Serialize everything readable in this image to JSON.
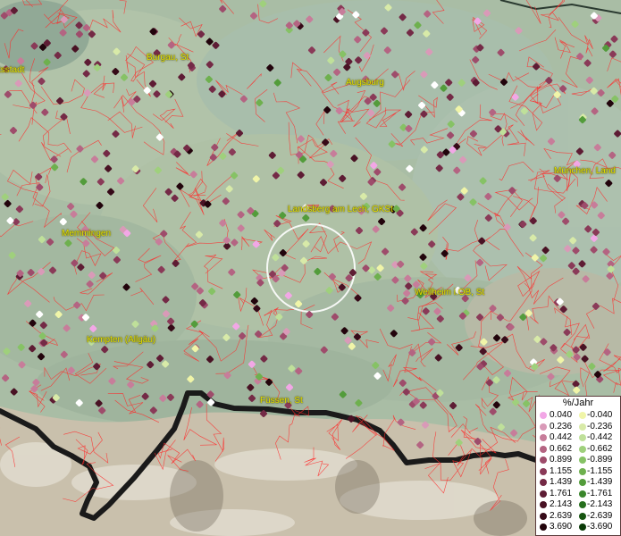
{
  "map": {
    "cities": [
      {
        "id": "ingolstadt",
        "label": "tsstadt"
      },
      {
        "id": "burgau",
        "label": "Burgau, St"
      },
      {
        "id": "augsburg",
        "label": "Augsburg"
      },
      {
        "id": "muenchen",
        "label": "München, Land"
      },
      {
        "id": "landsberg",
        "label": "Landsberg am Lech, GKSt"
      },
      {
        "id": "memmingen",
        "label": "Memmingen"
      },
      {
        "id": "weilheim",
        "label": "Weilheim i.OB, St"
      },
      {
        "id": "kempten",
        "label": "Kempten (Allgäu)"
      },
      {
        "id": "fuessen",
        "label": "Füssen, St"
      }
    ]
  },
  "legend": {
    "title": "%/Jahr",
    "rows": [
      {
        "pos": "0.040",
        "neg": "-0.040",
        "pos_color": "#f2a7e6",
        "neg_color": "#f0f5a8"
      },
      {
        "pos": "0.236",
        "neg": "-0.236",
        "pos_color": "#d99ab8",
        "neg_color": "#d8eaa8"
      },
      {
        "pos": "0.442",
        "neg": "-0.442",
        "pos_color": "#c77d9a",
        "neg_color": "#bfe09a"
      },
      {
        "pos": "0.662",
        "neg": "-0.662",
        "pos_color": "#b46482",
        "neg_color": "#9fd07c"
      },
      {
        "pos": "0.899",
        "neg": "-0.899",
        "pos_color": "#9e4c6b",
        "neg_color": "#86c265"
      },
      {
        "pos": "1.155",
        "neg": "-1.155",
        "pos_color": "#8a3a58",
        "neg_color": "#6eb04e"
      },
      {
        "pos": "1.439",
        "neg": "-1.439",
        "pos_color": "#742a46",
        "neg_color": "#539c3b"
      },
      {
        "pos": "1.761",
        "neg": "-1.761",
        "pos_color": "#5e1c34",
        "neg_color": "#3a862b"
      },
      {
        "pos": "2.143",
        "neg": "-2.143",
        "pos_color": "#491224",
        "neg_color": "#266e1c"
      },
      {
        "pos": "2.639",
        "neg": "-2.639",
        "pos_color": "#360a18",
        "neg_color": "#15540f"
      },
      {
        "pos": "3.690",
        "neg": "-3.690",
        "pos_color": "#22040c",
        "neg_color": "#093a07"
      }
    ]
  }
}
